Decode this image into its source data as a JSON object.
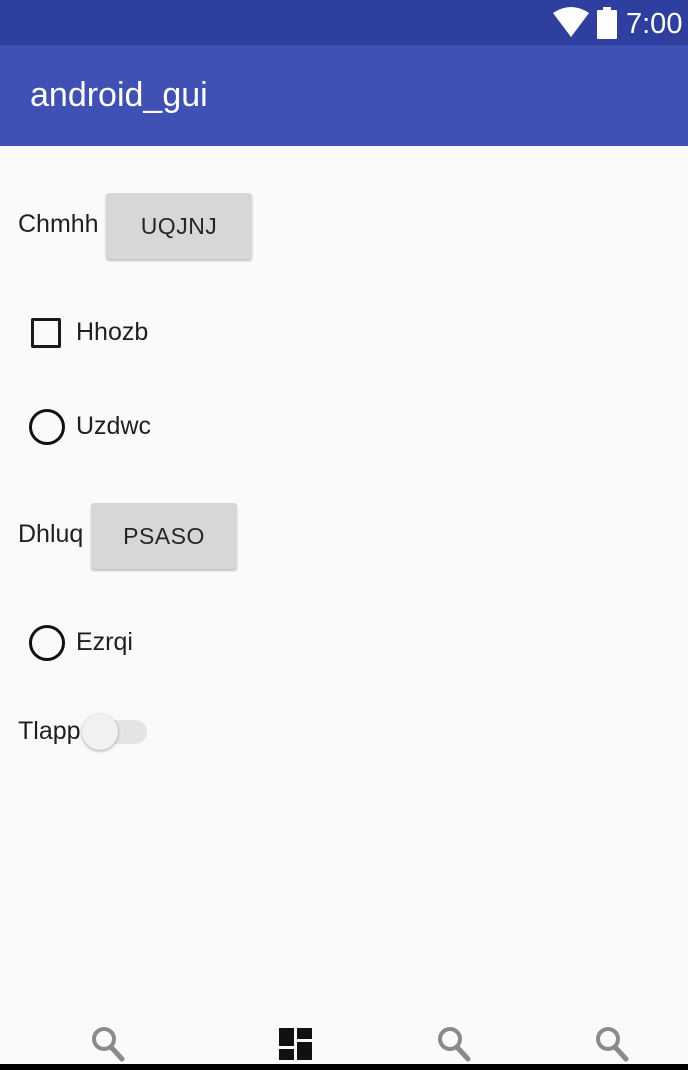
{
  "status_bar": {
    "time": "7:00",
    "icons": [
      "wifi-icon",
      "battery-icon"
    ]
  },
  "app_bar": {
    "title": "android_gui"
  },
  "content": {
    "row1": {
      "label": "Chmhh",
      "button": "UQJNJ"
    },
    "checkbox": {
      "label": "Hhozb",
      "checked": false
    },
    "radio1": {
      "label": "Uzdwc",
      "selected": false
    },
    "row2": {
      "label": "Dhluq",
      "button": "PSASO"
    },
    "radio2": {
      "label": "Ezrqi",
      "selected": false
    },
    "switch": {
      "label": "Tlapp",
      "on": false
    }
  },
  "bottom_nav": {
    "icons": [
      "search-icon",
      "dashboard-icon",
      "search-icon",
      "search-icon"
    ]
  },
  "colors": {
    "status_bar": "#2f3f9f",
    "app_bar": "#3f51b5",
    "background": "#fafafa",
    "button": "#d7d7d7"
  }
}
